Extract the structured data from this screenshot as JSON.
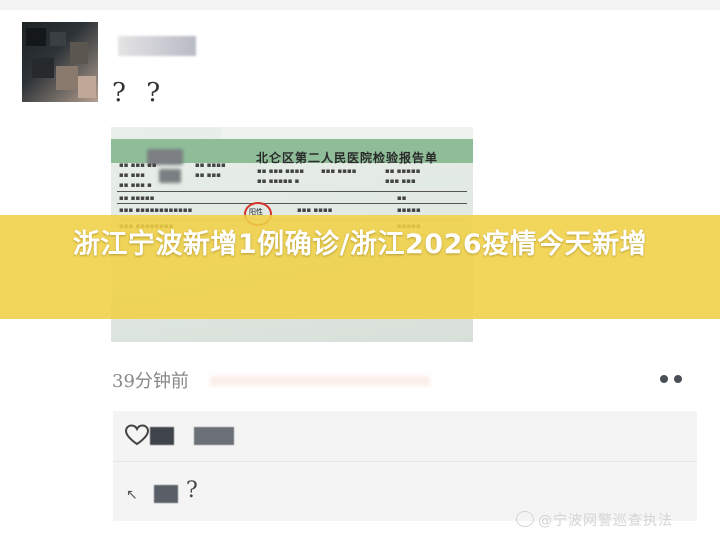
{
  "post": {
    "text": "? ?",
    "time": "39分钟前"
  },
  "report_photo": {
    "title": "北仑区第二人民医院检验报告单",
    "highlighted_result": "阳性"
  },
  "banner": {
    "title": "浙江宁波新增1例确诊/浙江2026疫情今天新增"
  },
  "comments": {
    "reply_text": "?"
  },
  "watermark": {
    "text": "@宁波网警巡查执法"
  },
  "colors": {
    "banner": "#f0d046",
    "report_header": "#8fbd98",
    "circle": "#d3342b"
  }
}
